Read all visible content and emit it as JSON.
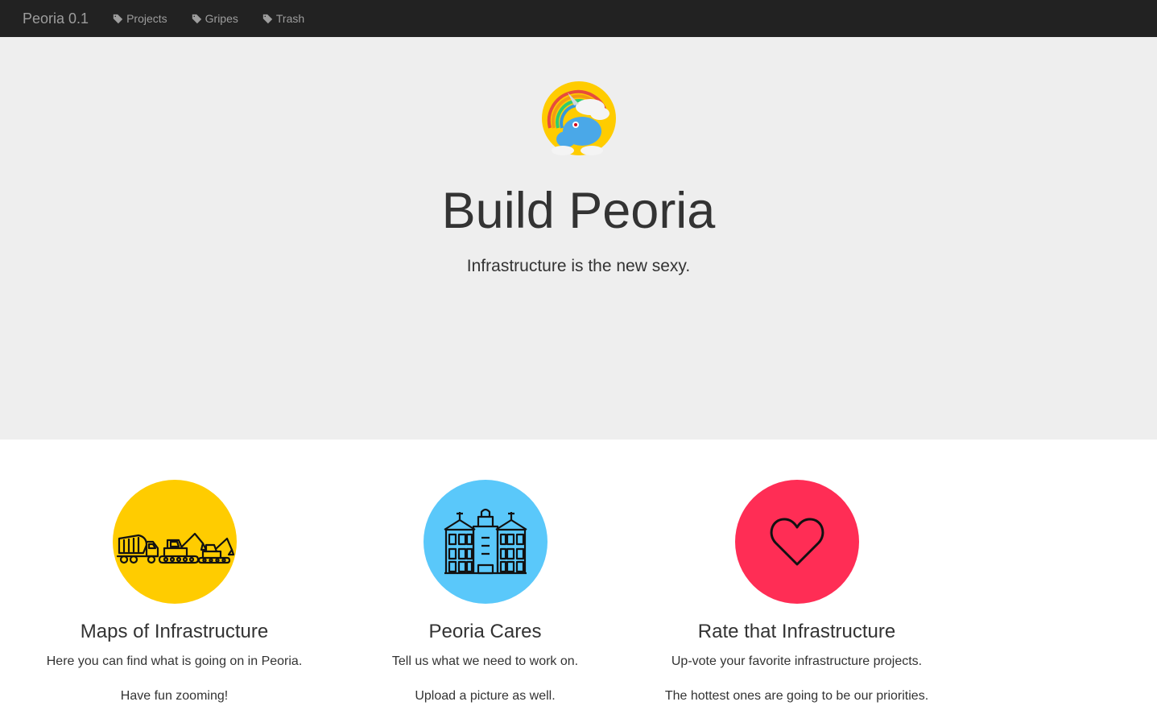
{
  "nav": {
    "brand": "Peoria 0.1",
    "links": [
      {
        "label": "Projects",
        "icon": "tag-icon"
      },
      {
        "label": "Gripes",
        "icon": "tag-icon"
      },
      {
        "label": "Trash",
        "icon": "tag-icon"
      }
    ]
  },
  "hero": {
    "logo": "unicorn-rainbow-logo",
    "title": "Build Peoria",
    "subtitle": "Infrastructure is the new sexy."
  },
  "features": [
    {
      "title": "Maps of Infrastructure",
      "line1": "Here you can find what is going on in Peoria.",
      "line2": "Have fun zooming!",
      "icon": "construction-vehicles-icon",
      "color": "#ffcc00"
    },
    {
      "title": "Peoria Cares",
      "line1": "Tell us what we need to work on.",
      "line2": "Upload a picture as well.",
      "icon": "city-hall-icon",
      "color": "#5ac8fa"
    },
    {
      "title": "Rate that Infrastructure",
      "line1": "Up-vote your favorite infrastructure projects.",
      "line2": "The hottest ones are going to be our priorities.",
      "icon": "heart-icon",
      "color": "#ff2d55"
    }
  ],
  "colors": {
    "navbar": "#222222",
    "nav_text": "#9d9d9d",
    "jumbotron": "#eeeeee"
  }
}
